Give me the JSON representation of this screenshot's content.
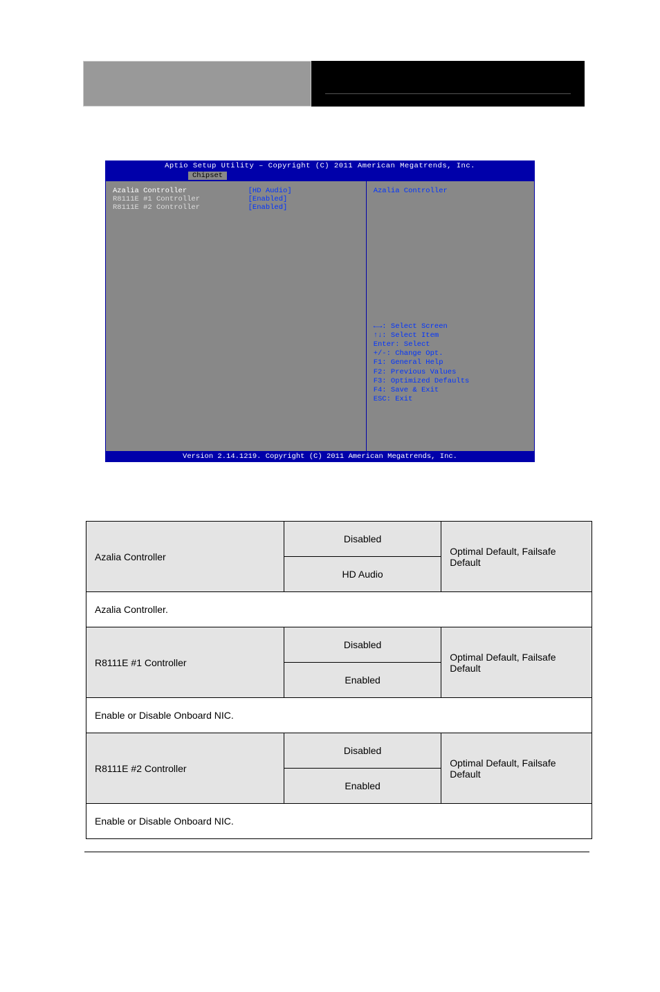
{
  "bios": {
    "title": "Aptio Setup Utility – Copyright (C) 2011 American Megatrends, Inc.",
    "menu": {
      "active": "Chipset"
    },
    "footer": "Version 2.14.1219. Copyright (C) 2011 American Megatrends, Inc.",
    "rows": [
      {
        "label": "Azalia Controller",
        "value": "[HD Audio]",
        "selected": true
      },
      {
        "label": "R8111E #1 Controller",
        "value": "[Enabled]",
        "selected": false
      },
      {
        "label": "R8111E #2 Controller",
        "value": "[Enabled]",
        "selected": false
      }
    ],
    "help_title": "Azalia Controller",
    "keys": [
      "←→: Select Screen",
      "↑↓: Select Item",
      "Enter: Select",
      "+/-: Change Opt.",
      "F1: General Help",
      "F2: Previous Values",
      "F3: Optimized Defaults",
      "F4: Save & Exit",
      "ESC: Exit"
    ]
  },
  "table": {
    "rows": [
      {
        "setting": "Azalia Controller",
        "options": [
          "Disabled",
          "HD Audio"
        ],
        "default_note": "Optimal Default, Failsafe Default",
        "desc": "Azalia Controller."
      },
      {
        "setting": "R8111E #1 Controller",
        "options": [
          "Disabled",
          "Enabled"
        ],
        "default_note": "Optimal Default, Failsafe Default",
        "desc": "Enable or Disable Onboard NIC."
      },
      {
        "setting": "R8111E #2 Controller",
        "options": [
          "Disabled",
          "Enabled"
        ],
        "default_note": "Optimal Default, Failsafe Default",
        "desc": "Enable or Disable Onboard NIC."
      }
    ]
  }
}
